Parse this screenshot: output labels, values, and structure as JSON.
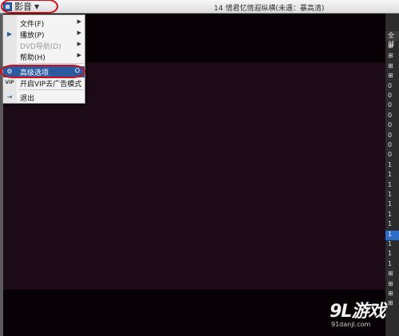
{
  "titlebar": {
    "app_button_label": "影音",
    "window_title": "14 惜君忆情遐纵横(未遇：暴高清)"
  },
  "menu": {
    "items": [
      {
        "label": "文件(F)",
        "icon": "",
        "has_submenu": true
      },
      {
        "label": "播放(P)",
        "icon": "play-icon",
        "has_submenu": true
      },
      {
        "label": "DVD导航(D)",
        "icon": "",
        "has_submenu": true,
        "disabled": true
      },
      {
        "label": "帮助(H)",
        "icon": "",
        "has_submenu": true
      },
      {
        "label": "高级选项",
        "icon": "gear-icon",
        "shortcut": "O",
        "highlighted": true
      },
      {
        "label": "开启VIP去广告模式",
        "icon": "VIP"
      },
      {
        "label": "退出",
        "icon": "exit-icon"
      }
    ],
    "vip_icon_text": "VIP"
  },
  "playlist": {
    "header": "全部",
    "rows": [
      "⊞",
      "⊞",
      "⊞",
      "⊞",
      "0",
      "0",
      "0",
      "0",
      "0",
      "0",
      "0",
      "0",
      "1",
      "1",
      "1",
      "1",
      "1",
      "1",
      "1",
      "1",
      "1",
      "1",
      "1",
      "⊞",
      "⊞",
      "⊞",
      "⊞"
    ],
    "active_index": 19
  },
  "watermark": {
    "brand": "9L游戏",
    "url": "91danji.com"
  },
  "colors": {
    "highlight": "#2b5aa0",
    "annotation_red": "#d20f1b",
    "video_bg": "#1d0a17"
  }
}
